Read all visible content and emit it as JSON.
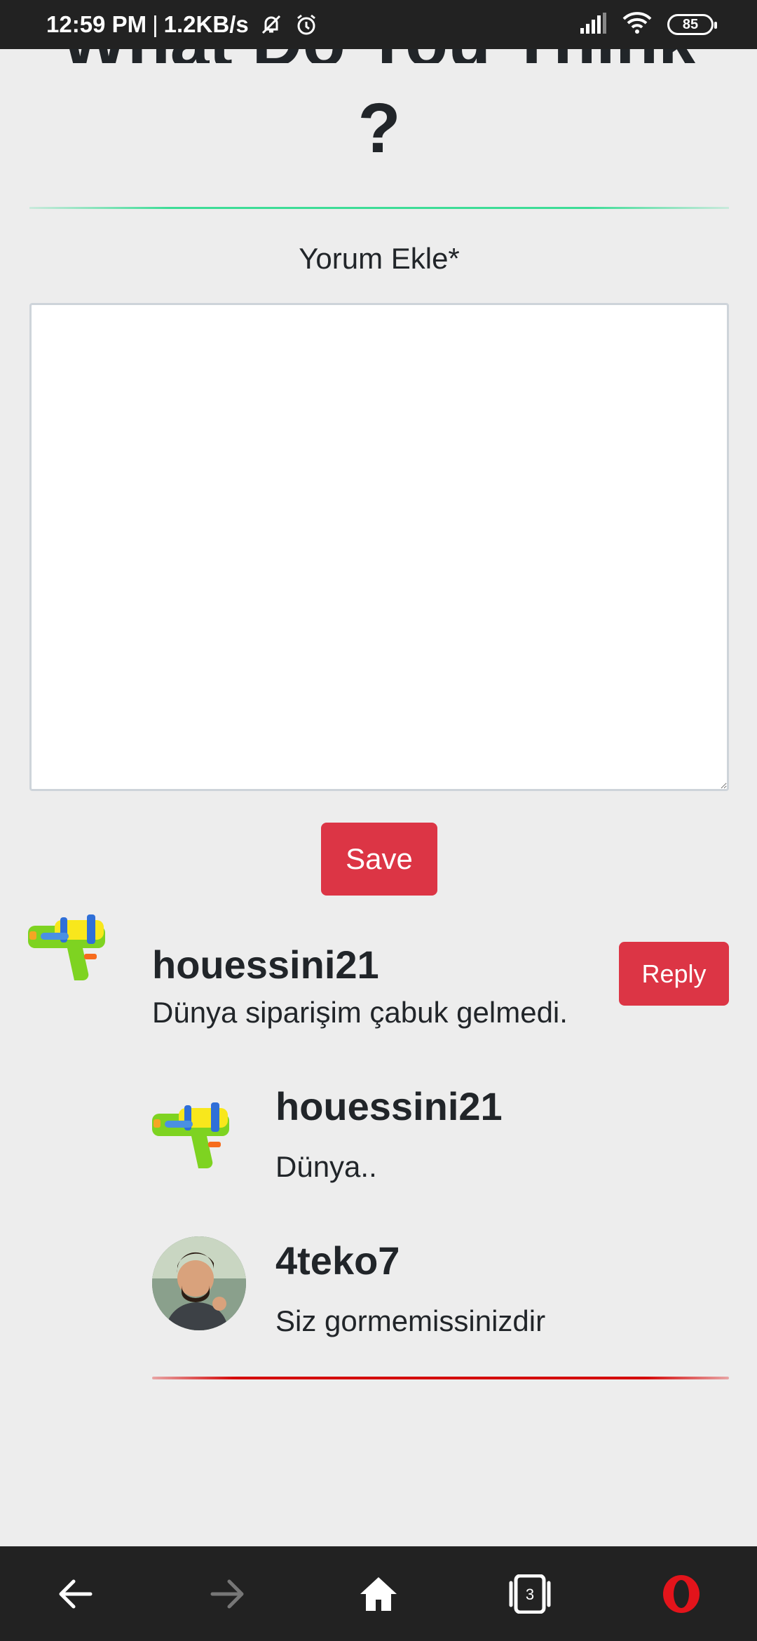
{
  "status_bar": {
    "time": "12:59 PM",
    "separator": "|",
    "speed": "1.2KB/s",
    "battery": "85",
    "icons": [
      "mute-icon",
      "alarm-icon",
      "signal-icon",
      "wifi-icon",
      "battery-icon"
    ]
  },
  "page": {
    "heading_partial": "What Do You Think",
    "heading_question": "?",
    "comment_label": "Yorum Ekle*",
    "comment_value": "",
    "save_label": "Save"
  },
  "comments": [
    {
      "username": "houessini21",
      "text": "Dünya siparişim çabuk gelmedi.",
      "avatar": "water-gun-avatar",
      "reply_label": "Reply",
      "replies": [
        {
          "username": "houessini21",
          "text": "Dünya..",
          "avatar": "water-gun-avatar"
        },
        {
          "username": "4teko7",
          "text": "Siz gormemissinizdir",
          "avatar": "user-photo-avatar"
        }
      ]
    }
  ],
  "nav": {
    "tab_count": "3",
    "items": [
      "back-arrow-icon",
      "forward-arrow-icon",
      "home-icon",
      "tabs-icon",
      "opera-icon"
    ]
  },
  "colors": {
    "accent_red": "#dc3545",
    "divider_green": "#3ddc97",
    "divider_red": "#d40000",
    "bar_dark": "#222222",
    "background": "#ededed",
    "opera_red": "#e3141b"
  }
}
